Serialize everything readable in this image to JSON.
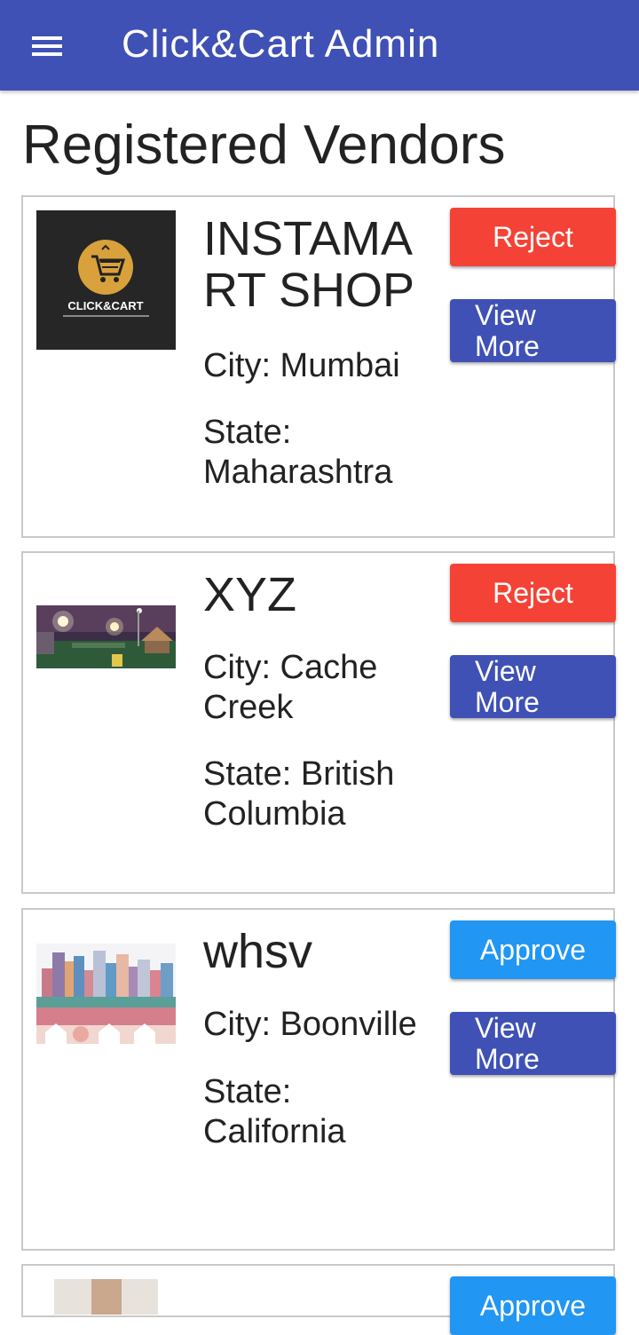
{
  "appbar": {
    "title": "Click&Cart Admin",
    "menu_icon": "hamburger-menu-icon",
    "color": "#3f51b5"
  },
  "page": {
    "title": "Registered Vendors"
  },
  "colors": {
    "reject": "#f44336",
    "approve": "#2196f3",
    "view_more": "#3f51b5"
  },
  "vendors": [
    {
      "name": "INSTAMART SHOP",
      "city": "City: Mumbai",
      "state": "State: Maharashtra",
      "action": "Reject",
      "more": "View More",
      "image": "click-and-cart-logo",
      "logo_text": "CLICK&CART"
    },
    {
      "name": "XYZ",
      "city": "City: Cache Creek",
      "state": "State: British Columbia",
      "action": "Reject",
      "more": "View More",
      "image": "night-fair-photo"
    },
    {
      "name": "whsv",
      "city": "City: Boonville",
      "state": "State: California",
      "action": "Approve",
      "more": "View More",
      "image": "city-skyline-illustration"
    },
    {
      "action": "Approve",
      "image": "person-photo"
    }
  ]
}
